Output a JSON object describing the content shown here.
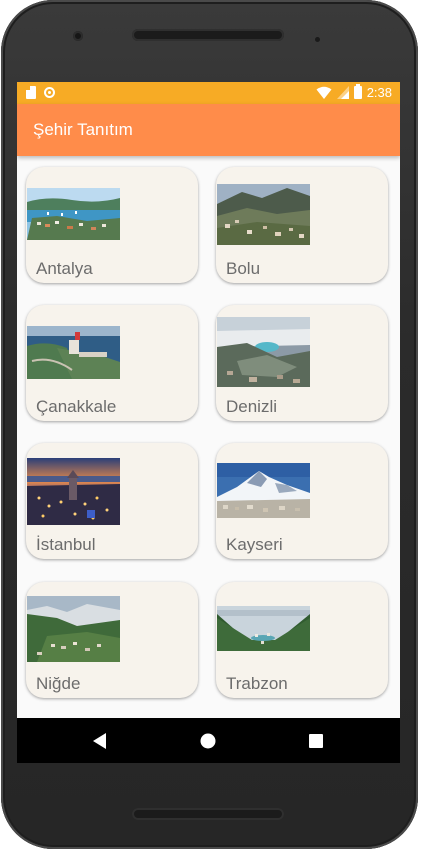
{
  "statusbar": {
    "time": "2:38",
    "icons": [
      "sd-card-icon",
      "circle-notification-icon",
      "wifi-icon",
      "signal-icon",
      "battery-icon"
    ]
  },
  "appbar": {
    "title": "Şehir Tanıtım"
  },
  "cities": [
    {
      "label": "Antalya",
      "image": "antalya-harbor-photo"
    },
    {
      "label": "Bolu",
      "image": "bolu-mountain-photo"
    },
    {
      "label": "Çanakkale",
      "image": "canakkale-memorial-photo"
    },
    {
      "label": "Denizli",
      "image": "denizli-travertine-photo"
    },
    {
      "label": "İstanbul",
      "image": "istanbul-galata-photo"
    },
    {
      "label": "Kayseri",
      "image": "kayseri-erciyes-photo"
    },
    {
      "label": "Niğde",
      "image": "nigde-valley-photo"
    },
    {
      "label": "Trabzon",
      "image": "trabzon-uzungol-photo"
    }
  ],
  "navbar": {
    "buttons": [
      "back-icon",
      "home-icon",
      "recents-icon"
    ]
  },
  "colors": {
    "statusbar": "#f7ab25",
    "appbar": "#ff8c4a",
    "card": "#f7f3ec",
    "label": "#6c6c6c"
  }
}
